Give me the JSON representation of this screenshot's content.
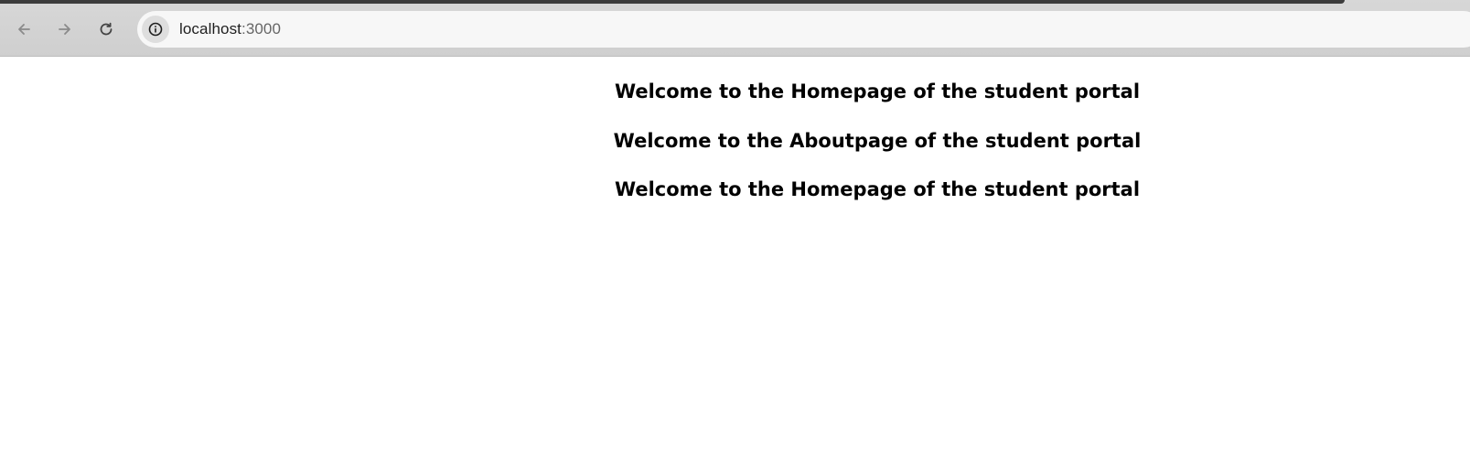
{
  "browser": {
    "url_host": "localhost",
    "url_port": ":3000",
    "icons": {
      "back": "arrow-left-icon",
      "forward": "arrow-right-icon",
      "reload": "reload-icon",
      "site_info": "info-icon"
    }
  },
  "page": {
    "headings": [
      "Welcome to the Homepage of the student portal",
      "Welcome to the Aboutpage of the student portal",
      "Welcome to the Homepage of the student portal"
    ]
  }
}
